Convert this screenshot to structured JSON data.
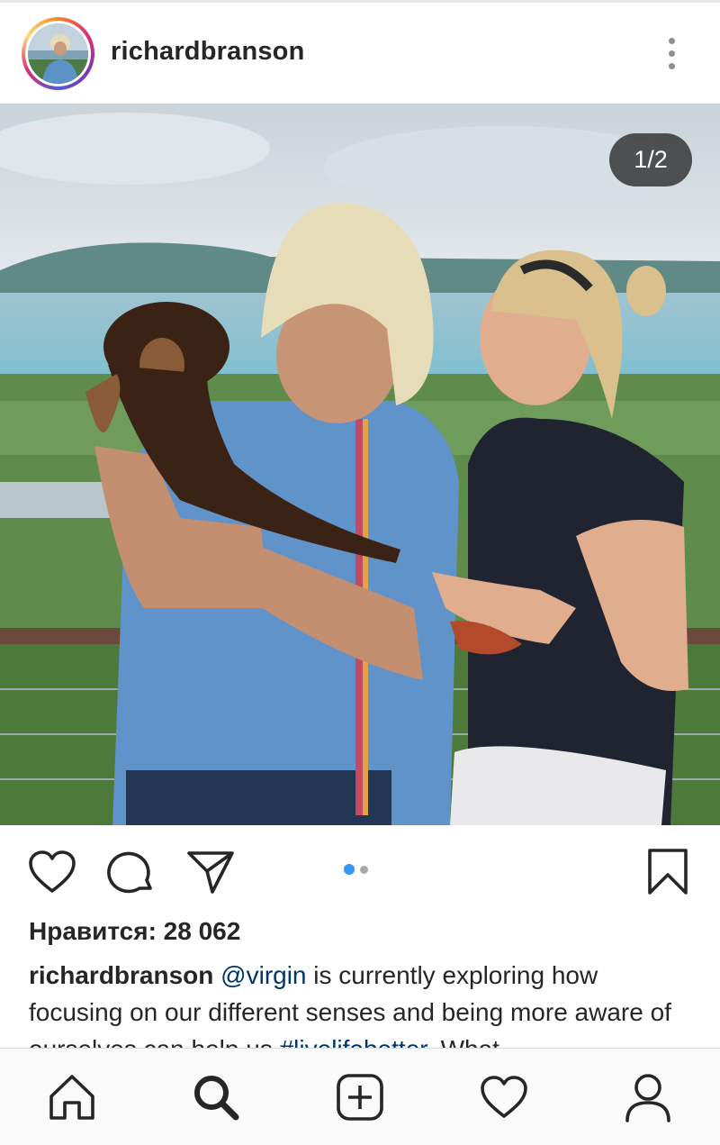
{
  "header": {
    "username": "richardbranson",
    "avatar_icon": "profile-photo",
    "more_icon": "more-vertical-icon"
  },
  "photo": {
    "counter": "1/2"
  },
  "actions": {
    "like_icon": "heart-outline-icon",
    "comment_icon": "comment-icon",
    "share_icon": "paper-plane-icon",
    "save_icon": "bookmark-icon",
    "carousel_current": 1,
    "carousel_total": 2
  },
  "likes": "Нравится: 28 062",
  "caption": {
    "username": "richardbranson",
    "mention": "@virgin",
    "text_1": " is currently exploring how focusing on our different senses and being more aware of ourselves can help us ",
    "hashtag": "#livelifebetter",
    "text_2": ". What"
  },
  "bottom_nav": {
    "items": [
      "home-icon",
      "search-icon",
      "add-post-icon",
      "activity-heart-icon",
      "profile-icon"
    ]
  },
  "colors": {
    "text": "#262626",
    "link": "#003569",
    "dot_active": "#3897f0",
    "dot_inactive": "#a8a8a8",
    "counter_bg": "#262626"
  }
}
